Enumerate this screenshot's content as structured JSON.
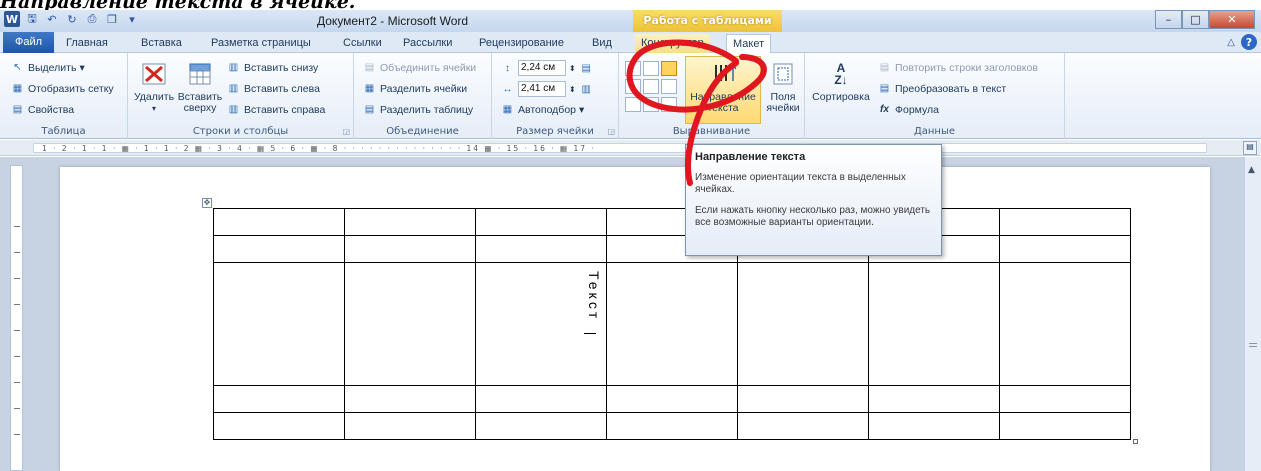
{
  "heading": "Направление текста в ячейке.",
  "window": {
    "title": "Документ2 - Microsoft Word",
    "context_group": "Работа с таблицами",
    "logo": "W"
  },
  "tabs": [
    "Файл",
    "Главная",
    "Вставка",
    "Разметка страницы",
    "Ссылки",
    "Рассылки",
    "Рецензирование",
    "Вид",
    "Конструктор",
    "Макет"
  ],
  "active_tab": "Макет",
  "ribbon": {
    "table": {
      "label": "Таблица",
      "select": "Выделить",
      "grid": "Отобразить сетку",
      "props": "Свойства"
    },
    "rows_cols": {
      "label": "Строки и столбцы",
      "delete": "Удалить",
      "insert_above_1": "Вставить",
      "insert_above_2": "сверху",
      "insert_below": "Вставить снизу",
      "insert_left": "Вставить слева",
      "insert_right": "Вставить справа"
    },
    "merge": {
      "label": "Объединение",
      "merge_cells": "Объединить ячейки",
      "split_cells": "Разделить ячейки",
      "split_table": "Разделить таблицу"
    },
    "cell_size": {
      "label": "Размер ячейки",
      "height": "2,24 см",
      "width": "2,41 см",
      "autofit": "Автоподбор"
    },
    "alignment": {
      "label": "Выравнивание",
      "text_dir_1": "Направление",
      "text_dir_2": "текста",
      "margins_1": "Поля",
      "margins_2": "ячейки"
    },
    "data": {
      "label": "Данные",
      "sort": "Сортировка",
      "repeat_headers": "Повторить строки заголовков",
      "convert": "Преобразовать в текст",
      "formula": "Формула"
    }
  },
  "ruler_text": "1 · 2 · 1 · 1 · ▦ · 1 · 1 · 2 ▦ · 3 · 4 · ▦ 5 · 6 · ▦ · 8 · · · · · · · · · · · · · · 14 ▦ · 15 · 16 · ▦ 17 ·",
  "document": {
    "cell_text": "Текст",
    "rows": 5,
    "cols": 7
  },
  "tooltip": {
    "title": "Направление текста",
    "line1": "Изменение ориентации текста в выделенных ячейках.",
    "line2": "Если нажать кнопку несколько раз, можно увидеть все возможные варианты ориентации."
  },
  "colors": {
    "annotation": "#e0171f",
    "accent": "#2b5797",
    "context": "#ecc33a"
  }
}
